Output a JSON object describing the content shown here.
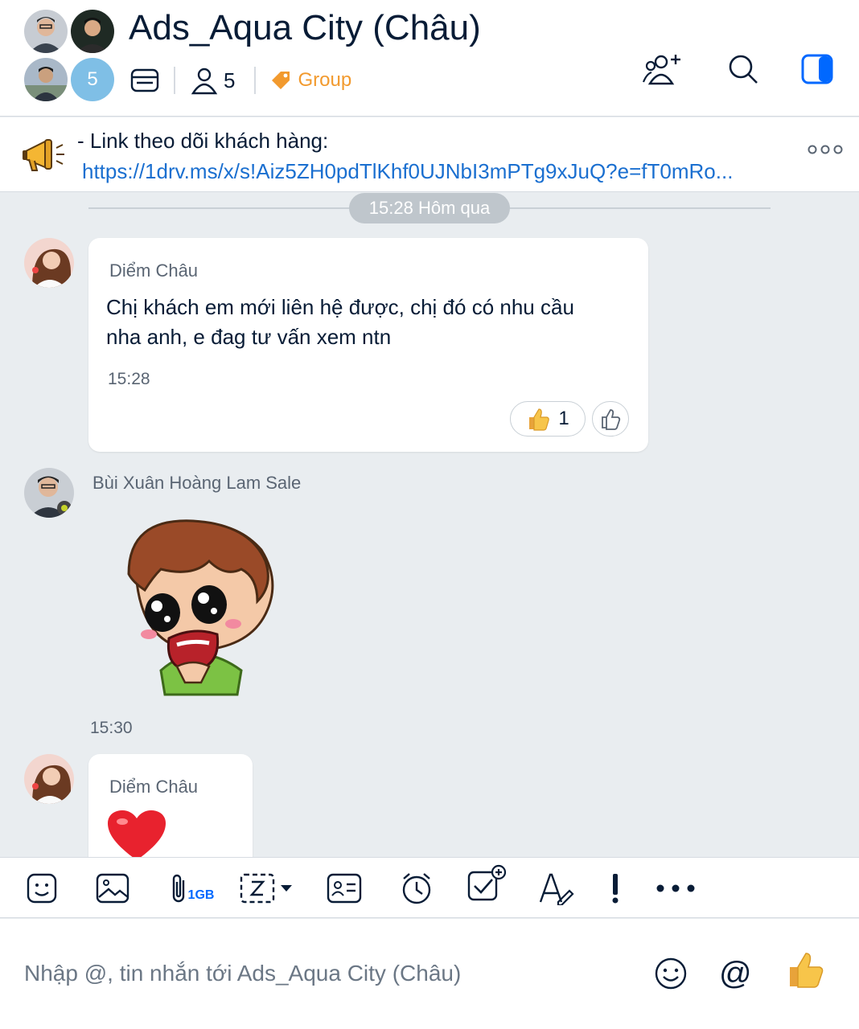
{
  "header": {
    "title": "Ads_Aqua City (Châu)",
    "hidden_member_count": "5",
    "member_count": "5",
    "group_tag": "Group"
  },
  "pinned": {
    "title": "- Link theo dõi khách hàng:",
    "link": "https://1drv.ms/x/s!Aiz5ZH0pdTlKhf0UJNbI3mPTg9xJuQ?e=fT0mRo..."
  },
  "chat": {
    "date_divider": "15:28 Hôm qua",
    "messages": [
      {
        "sender": "Diểm Châu",
        "text_line1": "Chị khách em mới liên hệ được, chị đó có nhu cầu",
        "text_line2": "nha anh, e đag tư vấn xem ntn",
        "time": "15:28",
        "reaction_count": "1"
      },
      {
        "sender": "Bùi Xuân Hoàng Lam Sale",
        "time": "15:30"
      },
      {
        "sender": "Diểm Châu"
      }
    ]
  },
  "toolbar": {
    "attach_size": "1GB"
  },
  "composer": {
    "placeholder": "Nhập @, tin nhắn tới Ads_Aqua City (Châu)"
  },
  "colors": {
    "accent": "#0068ff",
    "tag": "#f29a2e",
    "link": "#1a6fd0",
    "background": "#e9edf0"
  }
}
